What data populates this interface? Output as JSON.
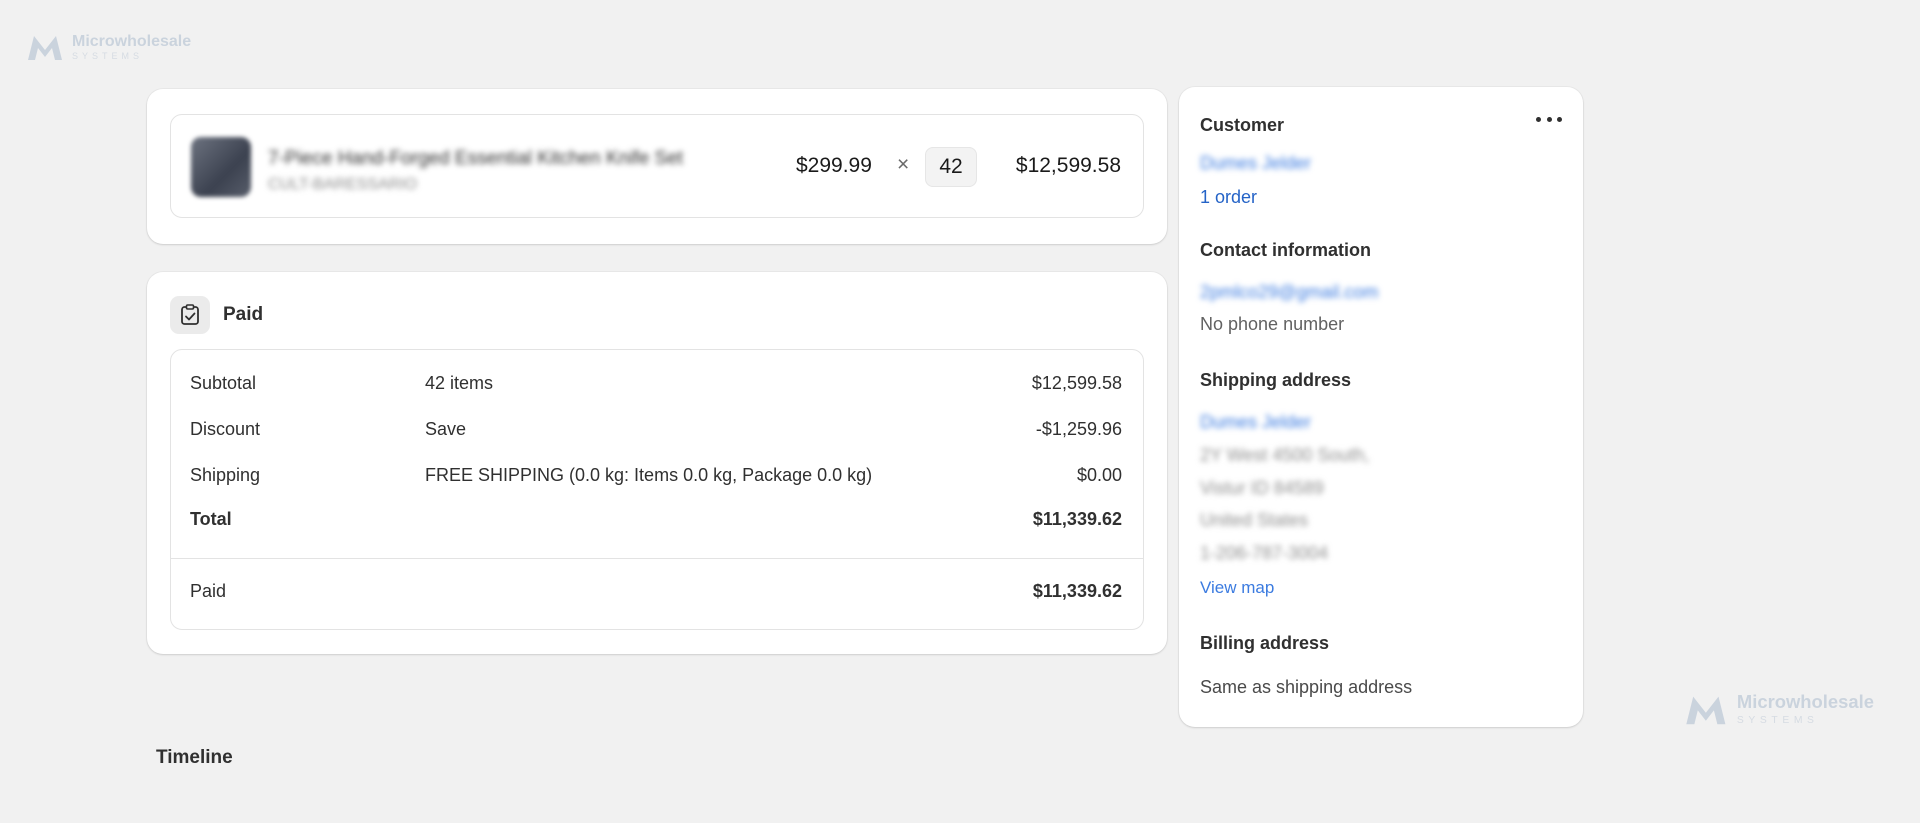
{
  "watermark": {
    "name": "Microwholesale",
    "sub": "SYSTEMS"
  },
  "product": {
    "name": "7-Piece Hand-Forged Essential Kitchen Knife Set",
    "sku": "CULT-BARESSARIO",
    "unit_price": "$299.99",
    "times_symbol": "×",
    "quantity": "42",
    "line_total": "$12,599.58"
  },
  "payment": {
    "status": "Paid",
    "rows": [
      {
        "label": "Subtotal",
        "detail": "42 items",
        "amount": "$12,599.58"
      },
      {
        "label": "Discount",
        "detail": "Save",
        "amount": "-$1,259.96"
      },
      {
        "label": "Shipping",
        "detail": "FREE SHIPPING (0.0 kg: Items 0.0 kg, Package 0.0 kg)",
        "amount": "$0.00"
      },
      {
        "label": "Total",
        "detail": "",
        "amount": "$11,339.62"
      }
    ],
    "paid": {
      "label": "Paid",
      "amount": "$11,339.62"
    }
  },
  "timeline": {
    "title": "Timeline"
  },
  "customer": {
    "title": "Customer",
    "name": "Dumes Jelder",
    "orders": "1 order",
    "contact_title": "Contact information",
    "email": "2pmlco29@gmail.com",
    "phone": "No phone number",
    "shipping_title": "Shipping address",
    "shipping": {
      "name": "Dumes Jelder",
      "line1": "2Y West 4500 South,",
      "line2": "Vistur ID 84589",
      "country": "United States",
      "phone": "1-206-787-3004"
    },
    "view_map": "View map",
    "billing_title": "Billing address",
    "billing_value": "Same as shipping address"
  },
  "colors": {
    "link": "#2463c7",
    "background": "#f1f1f1",
    "card": "#ffffff",
    "text": "#303030"
  }
}
